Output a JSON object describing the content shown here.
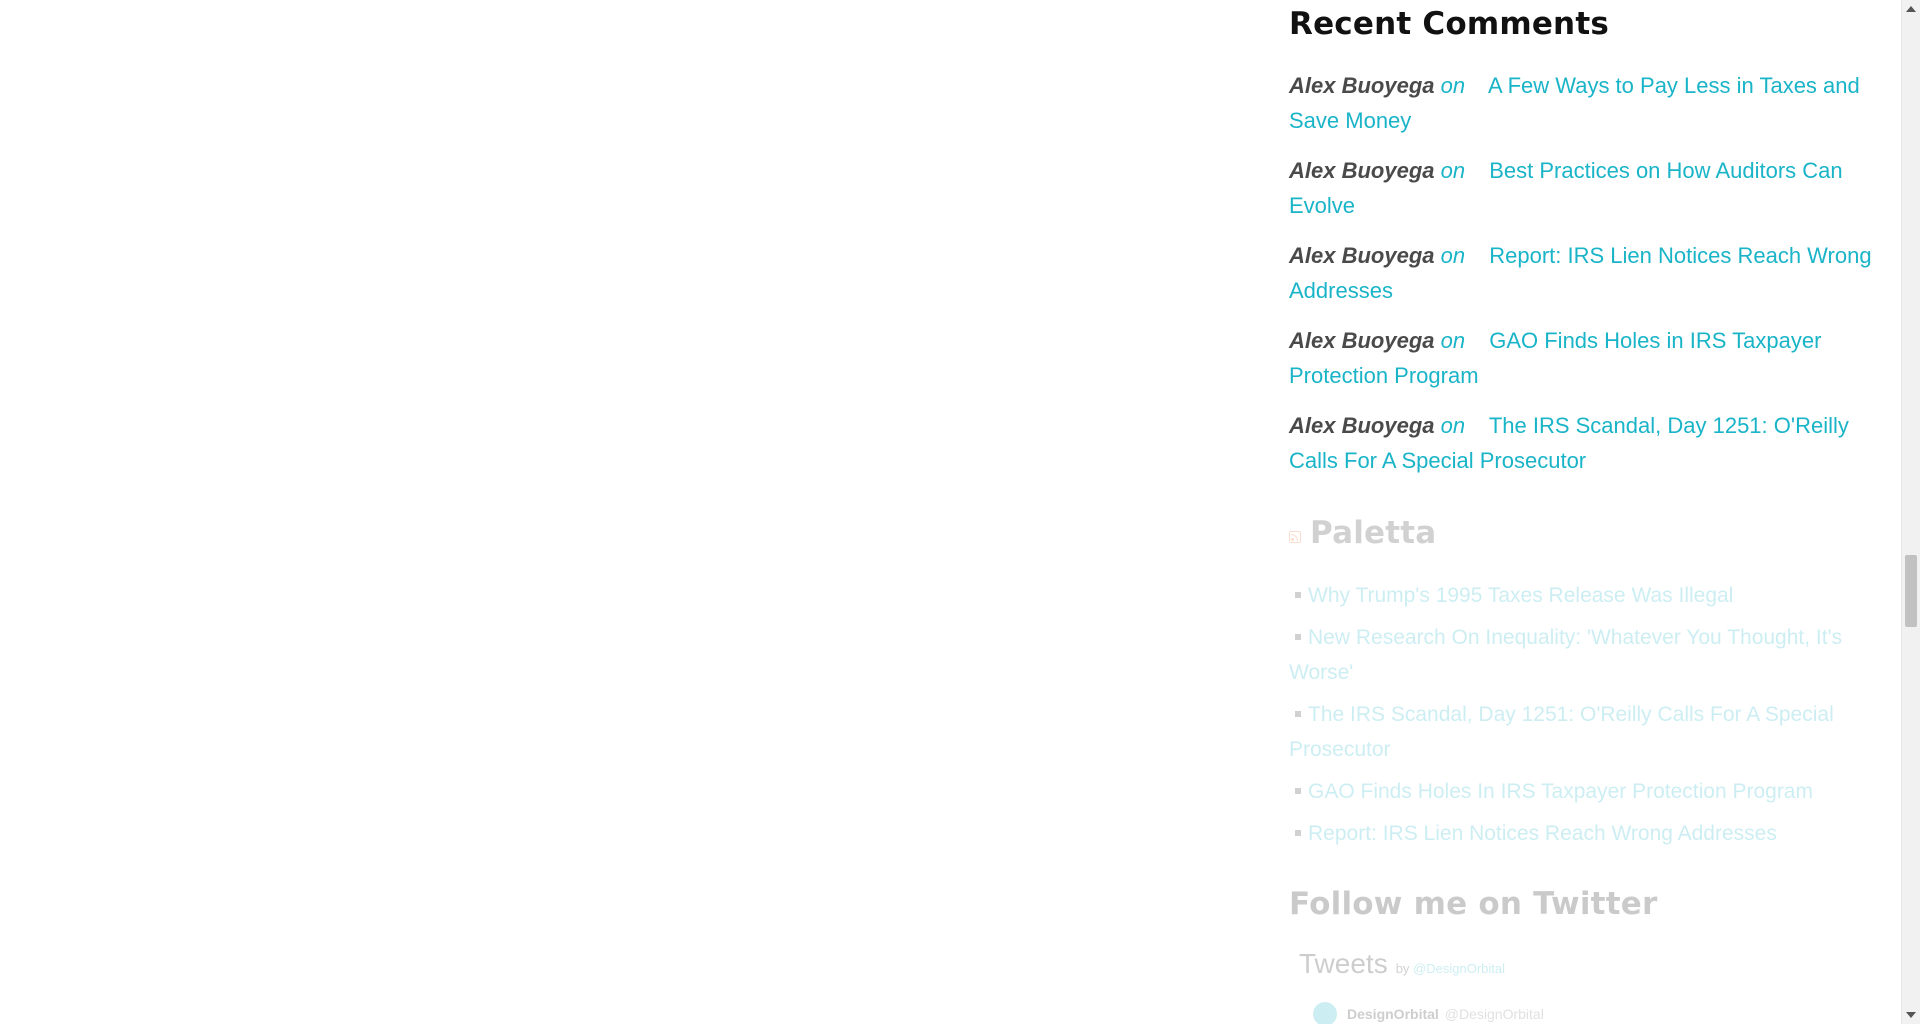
{
  "recent_comments": {
    "title": "Recent Comments",
    "on_label": "on",
    "items": [
      {
        "author": "Alex Buoyega",
        "post": "A Few Ways to Pay Less in Taxes and Save Money"
      },
      {
        "author": "Alex Buoyega",
        "post": "Best Practices on How Auditors Can Evolve"
      },
      {
        "author": "Alex Buoyega",
        "post": "Report: IRS Lien Notices Reach Wrong Addresses"
      },
      {
        "author": "Alex Buoyega",
        "post": "GAO Finds Holes in IRS Taxpayer Protection Program"
      },
      {
        "author": "Alex Buoyega",
        "post": "The IRS Scandal, Day 1251: O'Reilly Calls For A Special Prosecutor"
      }
    ]
  },
  "rss_widget": {
    "title": "Paletta",
    "icon": "rss-icon",
    "items": [
      "Why Trump's 1995 Taxes Release Was Illegal",
      "New Research On Inequality: 'Whatever You Thought, It's Worse'",
      "The IRS Scandal, Day 1251: O'Reilly Calls For A Special Prosecutor",
      "GAO Finds Holes In IRS Taxpayer Protection Program",
      "Report: IRS Lien Notices Reach Wrong Addresses"
    ]
  },
  "twitter_widget": {
    "title": "Follow me on Twitter",
    "tweets_label": "Tweets",
    "by_label": "by",
    "by_handle": "@DesignOrbital",
    "tweet": {
      "name": "DesignOrbital",
      "handle": "@DesignOrbital"
    }
  },
  "colors": {
    "link": "#1ab4c8",
    "heading": "#111111",
    "author": "#4a4a4a",
    "rss": "#f26522"
  }
}
